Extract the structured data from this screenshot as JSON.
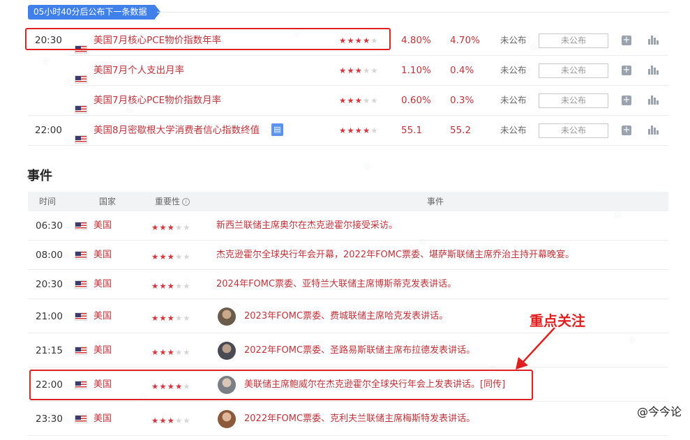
{
  "countdown_label": "05小时40分后公布下一条数据",
  "data_rows": [
    {
      "time": "20:30",
      "name": "美国7月核心PCE物价指数年率",
      "stars": 4,
      "prev": "4.80%",
      "pred": "4.70%",
      "status": "未公布",
      "actual": "未公布",
      "has_doc": false
    },
    {
      "time": "",
      "name": "美国7月个人支出月率",
      "stars": 3,
      "prev": "1.10%",
      "pred": "0.4%",
      "status": "未公布",
      "actual": "未公布",
      "has_doc": false
    },
    {
      "time": "",
      "name": "美国7月核心PCE物价指数月率",
      "stars": 3,
      "prev": "0.60%",
      "pred": "0.3%",
      "status": "未公布",
      "actual": "未公布",
      "has_doc": false
    },
    {
      "time": "22:00",
      "name": "美国8月密歇根大学消费者信心指数终值",
      "stars": 4,
      "prev": "55.1",
      "pred": "55.2",
      "status": "未公布",
      "actual": "未公布",
      "has_doc": true
    }
  ],
  "events_title": "事件",
  "events_header": {
    "time": "时间",
    "country": "国家",
    "importance": "重要性",
    "event": "事件"
  },
  "events": [
    {
      "time": "06:30",
      "country": "美国",
      "stars": 3,
      "avatar": false,
      "text": "新西兰联储主席奥尔在杰克逊霍尔接受采访。"
    },
    {
      "time": "08:00",
      "country": "美国",
      "stars": 3,
      "avatar": false,
      "text": "杰克逊霍尔全球央行年会开幕，2022年FOMC票委、堪萨斯联储主席乔治主持开幕晚宴。"
    },
    {
      "time": "20:30",
      "country": "美国",
      "stars": 3,
      "avatar": false,
      "text": "2024年FOMC票委、亚特兰大联储主席博斯蒂克发表讲话。"
    },
    {
      "time": "21:00",
      "country": "美国",
      "stars": 3,
      "avatar": true,
      "text": "2023年FOMC票委、费城联储主席哈克发表讲话。"
    },
    {
      "time": "21:15",
      "country": "美国",
      "stars": 3,
      "avatar": true,
      "text": "2022年FOMC票委、圣路易斯联储主席布拉德发表讲话。"
    },
    {
      "time": "22:00",
      "country": "美国",
      "stars": 4,
      "avatar": true,
      "text": "美联储主席鲍威尔在杰克逊霍尔全球央行年会上发表讲话。[同传]"
    },
    {
      "time": "23:30",
      "country": "美国",
      "stars": 3,
      "avatar": true,
      "text": "2022年FOMC票委、克利夫兰联储主席梅斯特发表讲话。"
    }
  ],
  "annotation_label": "重点关注",
  "brand_label": "@今今论",
  "colors": {
    "accent_red": "#c0333a",
    "highlight": "#e02020",
    "countdown_bg": "#3f80ea"
  }
}
